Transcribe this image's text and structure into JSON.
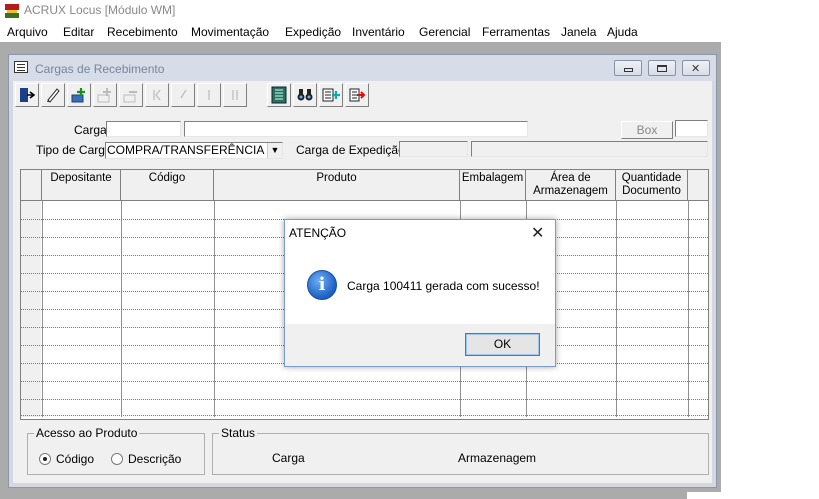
{
  "app": {
    "title": "ACRUX Locus [Módulo WM]"
  },
  "menu": [
    "Arquivo",
    "Editar",
    "Recebimento",
    "Movimentação",
    "Expedição",
    "Inventário",
    "Gerencial",
    "Ferramentas",
    "Janela",
    "Ajuda"
  ],
  "window": {
    "title": "Cargas de Recebimento"
  },
  "toolbar": {
    "buttons": [
      {
        "icon": "exit-icon",
        "glyph": "⇤",
        "enabled": true
      },
      {
        "icon": "eraser-icon",
        "glyph": "✎",
        "enabled": true
      },
      {
        "icon": "new-record-icon",
        "glyph": "✚",
        "enabled": true
      },
      {
        "icon": "add-disabled-icon",
        "glyph": "✚",
        "enabled": false
      },
      {
        "icon": "remove-disabled-icon",
        "glyph": "▭",
        "enabled": false
      },
      {
        "icon": "first-disabled-icon",
        "glyph": "|",
        "enabled": false
      },
      {
        "icon": "prev-disabled-icon",
        "glyph": "/",
        "enabled": false
      },
      {
        "icon": "next-disabled-icon",
        "glyph": "|",
        "enabled": false
      },
      {
        "icon": "last-disabled-icon",
        "glyph": "||",
        "enabled": false
      },
      {
        "icon": "grid-icon",
        "glyph": "▦",
        "enabled": true
      },
      {
        "icon": "binoculars-icon",
        "glyph": "👁",
        "enabled": true
      },
      {
        "icon": "insert-row-icon",
        "glyph": "⊞",
        "enabled": true
      },
      {
        "icon": "import-icon",
        "glyph": "⇥",
        "enabled": true
      }
    ]
  },
  "form": {
    "carga_label": "Carga",
    "carga_value": "",
    "carga_desc_value": "",
    "box_button": "Box",
    "box_value": "",
    "tipo_label": "Tipo de Carga",
    "tipo_value": "COMPRA/TRANSFERÊNCIA",
    "expedicao_label": "Carga de Expedição",
    "expedicao_value": "",
    "expedicao_desc_value": ""
  },
  "grid": {
    "columns": [
      {
        "line1": "Depositante",
        "line2": ""
      },
      {
        "line1": "Código",
        "line2": ""
      },
      {
        "line1": "Produto",
        "line2": ""
      },
      {
        "line1": "Embalagem",
        "line2": ""
      },
      {
        "line1": "Área de",
        "line2": "Armazenagem"
      },
      {
        "line1": "Quantidade",
        "line2": "Documento"
      }
    ]
  },
  "acesso": {
    "title": "Acesso ao Produto",
    "option_codigo": "Código",
    "option_descricao": "Descrição",
    "selected": "Código"
  },
  "status": {
    "title": "Status",
    "carga": "Carga",
    "armazenagem": "Armazenagem"
  },
  "dialog": {
    "title": "ATENÇÃO",
    "message": "Carga 100411 gerada com sucesso!",
    "ok": "OK",
    "close_glyph": "✕"
  },
  "colors": {
    "menu_text": "#000000",
    "mdi_background": "#ababab",
    "window_title_bg": "#d6dde9"
  }
}
